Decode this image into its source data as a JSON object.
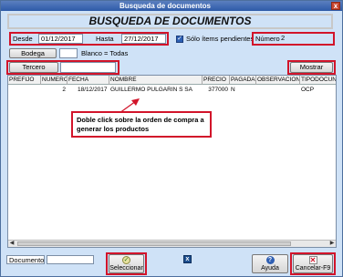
{
  "window": {
    "title": "Busqueda de documentos",
    "close_glyph": "x"
  },
  "heading": "BUSQUEDA DE DOCUMENTOS",
  "filters": {
    "desde_label": "Desde",
    "desde_value": "01/12/2017",
    "hasta_label": "Hasta",
    "hasta_value": "27/12/2017",
    "solo_pendientes_label": "Sólo ítems pendientes",
    "numero_label": "Número",
    "numero_value": "2",
    "bodega_button": "Bodega",
    "bodega_value": "",
    "bodega_hint": "Blanco = Todas",
    "tercero_button": "Tercero",
    "tercero_value": "",
    "mostrar_button": "Mostrar"
  },
  "grid": {
    "columns": [
      "PREFIJO",
      "NUMERO",
      "FECHA",
      "NOMBRE",
      "PRECIO",
      "PAGADA",
      "OBSERVACION",
      "TIPODOCUN"
    ],
    "rows": [
      [
        "",
        "2",
        "18/12/2017",
        "GUILLERMO PULGARIN S SA",
        "377000",
        "N",
        "",
        "OCP"
      ]
    ],
    "scroll_left": "◀",
    "scroll_right": "▶"
  },
  "callout": "Doble click sobre la orden de compra a generar los productos",
  "footer": {
    "documento_label": "Documento",
    "documento_value": "",
    "seleccionar_button": "Seleccionar",
    "ayuda_button": "Ayuda",
    "cancelar_button": "Cancelar-F9"
  },
  "colors": {
    "highlight": "#d2142a",
    "window_bg": "#cfe2f7",
    "title_bar": "#2e5aa8"
  },
  "icons": [
    "checkmark-icon",
    "excel-icon",
    "help-icon",
    "cancel-icon",
    "close-icon"
  ]
}
